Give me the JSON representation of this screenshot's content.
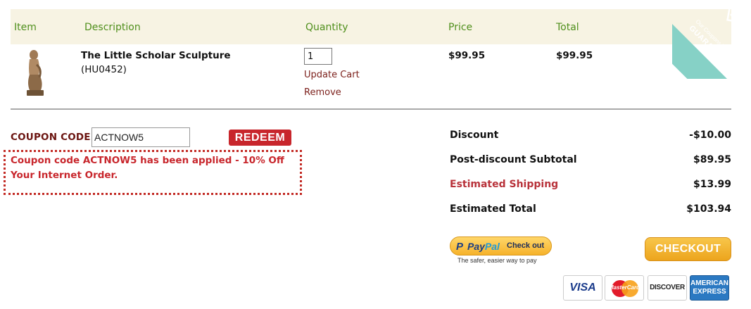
{
  "header": {
    "columns": [
      "Item",
      "Description",
      "Quantity",
      "Price",
      "Total"
    ]
  },
  "product": {
    "name": "The Little Scholar Sculpture",
    "sku": "(HU0452)",
    "quantity": "1",
    "update_label": "Update Cart",
    "remove_label": "Remove",
    "price": "$99.95",
    "total": "$99.95"
  },
  "coupon": {
    "label": "COUPON CODE",
    "value": "ACTNOW5",
    "redeem_label": "REDEEM",
    "message": "Coupon code ACTNOW5 has been applied - 10% Off Your Internet Order."
  },
  "summary": [
    {
      "label": "Discount",
      "value": "-$10.00"
    },
    {
      "label": "Post-discount Subtotal",
      "value": "$89.95"
    },
    {
      "label": "Estimated Shipping",
      "value": "$13.99"
    },
    {
      "label": "Estimated Total",
      "value": "$103.94"
    }
  ],
  "paypal": {
    "pay": "Pay",
    "pal": "Pal",
    "check_out": "Check out",
    "tagline": "The safer, easier way to pay"
  },
  "checkout_label": "CHECKOUT",
  "cards": {
    "visa": "VISA",
    "mastercard": "MasterCard",
    "discover": "DISCOVER",
    "amex_line1": "AMERICAN",
    "amex_line2": "EXPRESS"
  },
  "ribbon": {
    "line1": "Our Coupons Work",
    "line2": "GUARANTEED"
  },
  "colors": {
    "header_bg": "#f7f3e3",
    "header_text": "#4f8f1c",
    "accent_red": "#c8262c",
    "ribbon": "#86d1c6",
    "checkout": "#f0ae2a"
  }
}
